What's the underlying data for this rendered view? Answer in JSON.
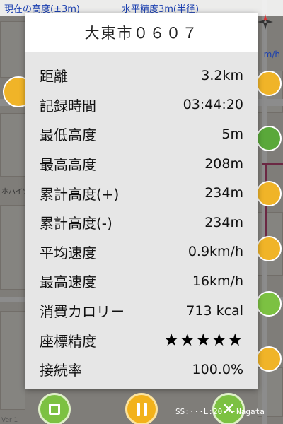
{
  "map": {
    "header_left": "現在の高度(±3m)",
    "header_right": "水平精度3m(半径)",
    "speed_unit": "m/h",
    "label_left": "ホハイツ",
    "scale_label": "Ver 1"
  },
  "dialog": {
    "title": "大東市０６０７",
    "rows": [
      {
        "label": "距離",
        "value": "3.2km"
      },
      {
        "label": "記録時間",
        "value": "03:44:20"
      },
      {
        "label": "最低高度",
        "value": "5m"
      },
      {
        "label": "最高高度",
        "value": "208m"
      },
      {
        "label": "累計高度(+)",
        "value": "234m"
      },
      {
        "label": "累計高度(-)",
        "value": "234m"
      },
      {
        "label": "平均速度",
        "value": "0.9km/h"
      },
      {
        "label": "最高速度",
        "value": "16km/h"
      },
      {
        "label": "消費カロリー",
        "value": "713 kcal"
      },
      {
        "label": "座標精度",
        "value": "★★★★★"
      },
      {
        "label": "接続率",
        "value": "100.0%"
      }
    ]
  },
  "controls": {
    "stop": "stop-icon",
    "pause": "pause-icon",
    "close": "close-icon",
    "close_glyph": "✕"
  },
  "watermark": "SS:···L:20···Nagata",
  "colors": {
    "accent_green": "#7cc142",
    "accent_yellow": "#f2b21b",
    "header_blue": "#1a3fb0"
  }
}
